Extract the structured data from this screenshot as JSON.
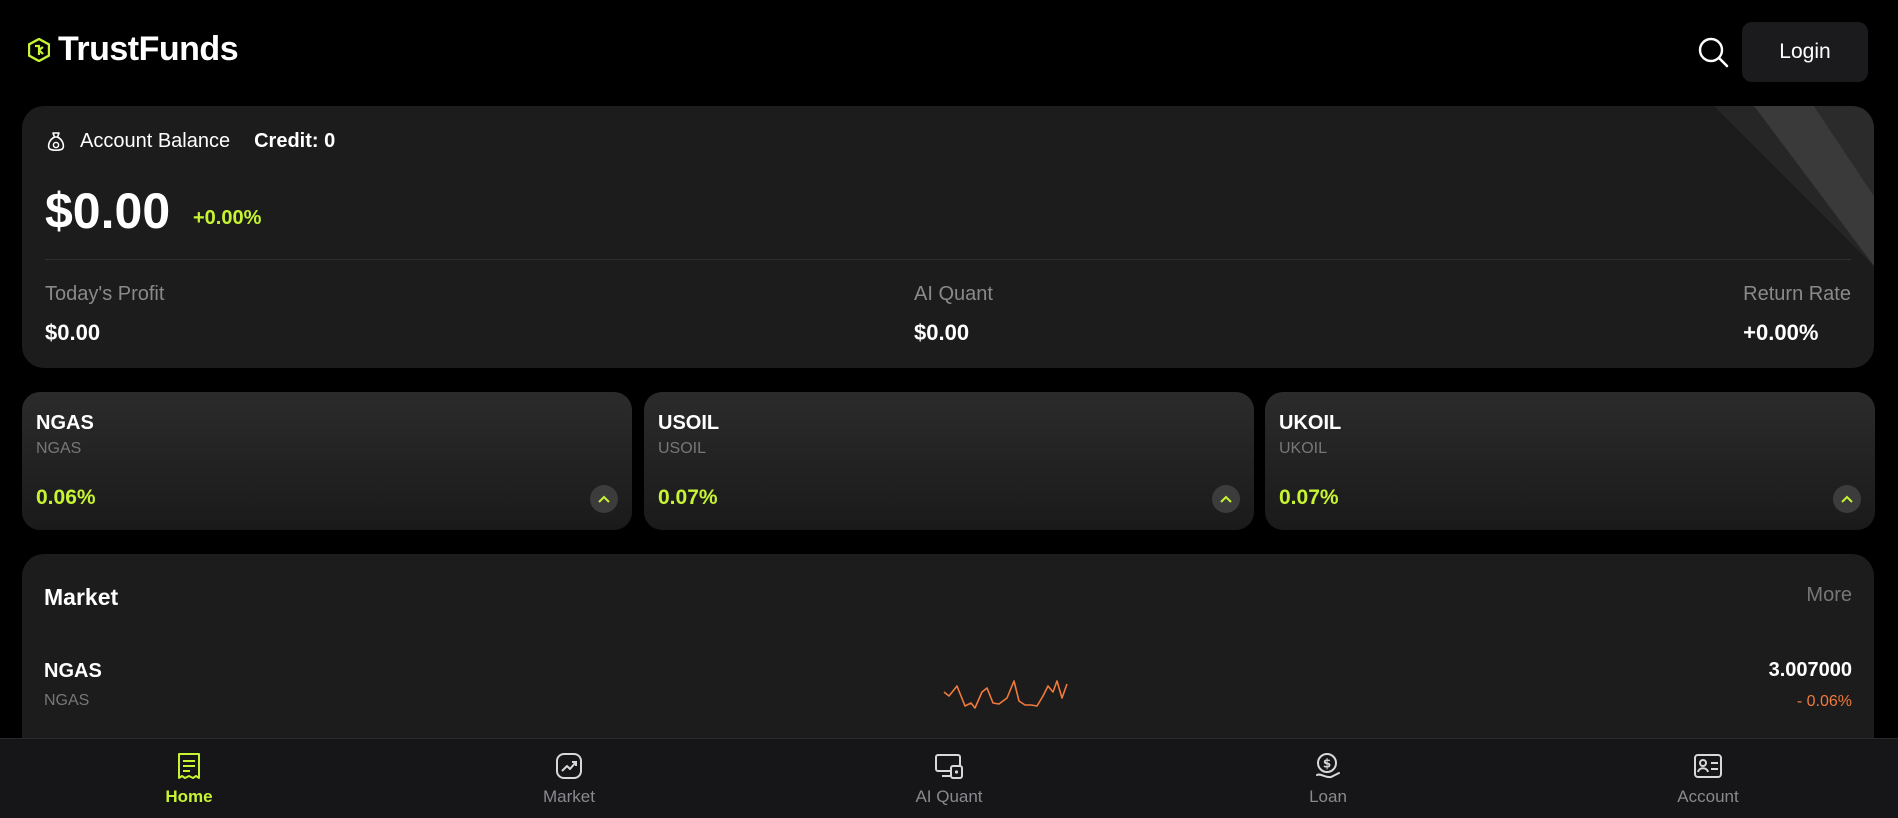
{
  "brand": {
    "name": "TrustFunds",
    "accent": "#c6f432"
  },
  "header": {
    "login_label": "Login"
  },
  "balance": {
    "label": "Account Balance",
    "credit": "Credit: 0",
    "amount": "$0.00",
    "change": "+0.00%",
    "stats": [
      {
        "label": "Today's Profit",
        "value": "$0.00"
      },
      {
        "label": "AI Quant",
        "value": "$0.00"
      },
      {
        "label": "Return Rate",
        "value": "+0.00%"
      }
    ]
  },
  "tickers": [
    {
      "name": "NGAS",
      "sub": "NGAS",
      "pct": "0.06%"
    },
    {
      "name": "USOIL",
      "sub": "USOIL",
      "pct": "0.07%"
    },
    {
      "name": "UKOIL",
      "sub": "UKOIL",
      "pct": "0.07%"
    }
  ],
  "market": {
    "title": "Market",
    "more_label": "More",
    "rows": [
      {
        "name": "NGAS",
        "sub": "NGAS",
        "price": "3.007000",
        "change": "- 0.06%",
        "spark_color": "#f17a3b"
      }
    ]
  },
  "nav": {
    "items": [
      {
        "label": "Home",
        "icon": "receipt-icon",
        "active": true
      },
      {
        "label": "Market",
        "icon": "trend-icon",
        "active": false
      },
      {
        "label": "AI Quant",
        "icon": "monitor-lock-icon",
        "active": false
      },
      {
        "label": "Loan",
        "icon": "coin-hand-icon",
        "active": false
      },
      {
        "label": "Account",
        "icon": "id-card-icon",
        "active": false
      }
    ]
  }
}
